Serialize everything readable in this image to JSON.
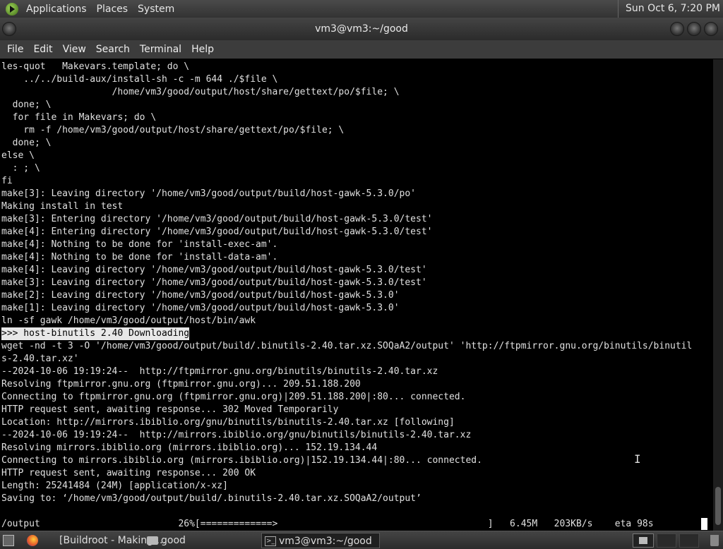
{
  "top_panel": {
    "menus": [
      "Applications",
      "Places",
      "System"
    ],
    "clock": "Sun Oct  6,  7:20 PM"
  },
  "window": {
    "title": "vm3@vm3:~/good"
  },
  "menu_bar": [
    "File",
    "Edit",
    "View",
    "Search",
    "Terminal",
    "Help"
  ],
  "terminal": {
    "lines": [
      "les-quot   Makevars.template; do \\",
      "    ../../build-aux/install-sh -c -m 644 ./$file \\",
      "                    /home/vm3/good/output/host/share/gettext/po/$file; \\",
      "  done; \\",
      "  for file in Makevars; do \\",
      "    rm -f /home/vm3/good/output/host/share/gettext/po/$file; \\",
      "  done; \\",
      "else \\",
      "  : ; \\",
      "fi",
      "make[3]: Leaving directory '/home/vm3/good/output/build/host-gawk-5.3.0/po'",
      "Making install in test",
      "make[3]: Entering directory '/home/vm3/good/output/build/host-gawk-5.3.0/test'",
      "make[4]: Entering directory '/home/vm3/good/output/build/host-gawk-5.3.0/test'",
      "make[4]: Nothing to be done for 'install-exec-am'.",
      "make[4]: Nothing to be done for 'install-data-am'.",
      "make[4]: Leaving directory '/home/vm3/good/output/build/host-gawk-5.3.0/test'",
      "make[3]: Leaving directory '/home/vm3/good/output/build/host-gawk-5.3.0/test'",
      "make[2]: Leaving directory '/home/vm3/good/output/build/host-gawk-5.3.0'",
      "make[1]: Leaving directory '/home/vm3/good/output/build/host-gawk-5.3.0'",
      "ln -sf gawk /home/vm3/good/output/host/bin/awk",
      ">>> host-binutils 2.40 Downloading",
      "wget -nd -t 3 -O '/home/vm3/good/output/build/.binutils-2.40.tar.xz.SOQaA2/output' 'http://ftpmirror.gnu.org/binutils/binutil",
      "s-2.40.tar.xz'",
      "--2024-10-06 19:19:24--  http://ftpmirror.gnu.org/binutils/binutils-2.40.tar.xz",
      "Resolving ftpmirror.gnu.org (ftpmirror.gnu.org)... 209.51.188.200",
      "Connecting to ftpmirror.gnu.org (ftpmirror.gnu.org)|209.51.188.200|:80... connected.",
      "HTTP request sent, awaiting response... 302 Moved Temporarily",
      "Location: http://mirrors.ibiblio.org/gnu/binutils/binutils-2.40.tar.xz [following]",
      "--2024-10-06 19:19:24--  http://mirrors.ibiblio.org/gnu/binutils/binutils-2.40.tar.xz",
      "Resolving mirrors.ibiblio.org (mirrors.ibiblio.org)... 152.19.134.44",
      "Connecting to mirrors.ibiblio.org (mirrors.ibiblio.org)|152.19.134.44|:80... connected.",
      "HTTP request sent, awaiting response... 200 OK",
      "Length: 25241484 (24M) [application/x-xz]",
      "Saving to: ‘/home/vm3/good/output/build/.binutils-2.40.tar.xz.SOQaA2/output’",
      "",
      "/output                         26%[=============>                                      ]   6.45M   203KB/s    eta 98s"
    ],
    "highlighted_line": ">>> host-binutils 2.40 Downloading",
    "download_progress_percent": 26
  },
  "taskbar": {
    "tasks": [
      "[Buildroot - Making ...",
      "good",
      "vm3@vm3:~/good"
    ]
  }
}
